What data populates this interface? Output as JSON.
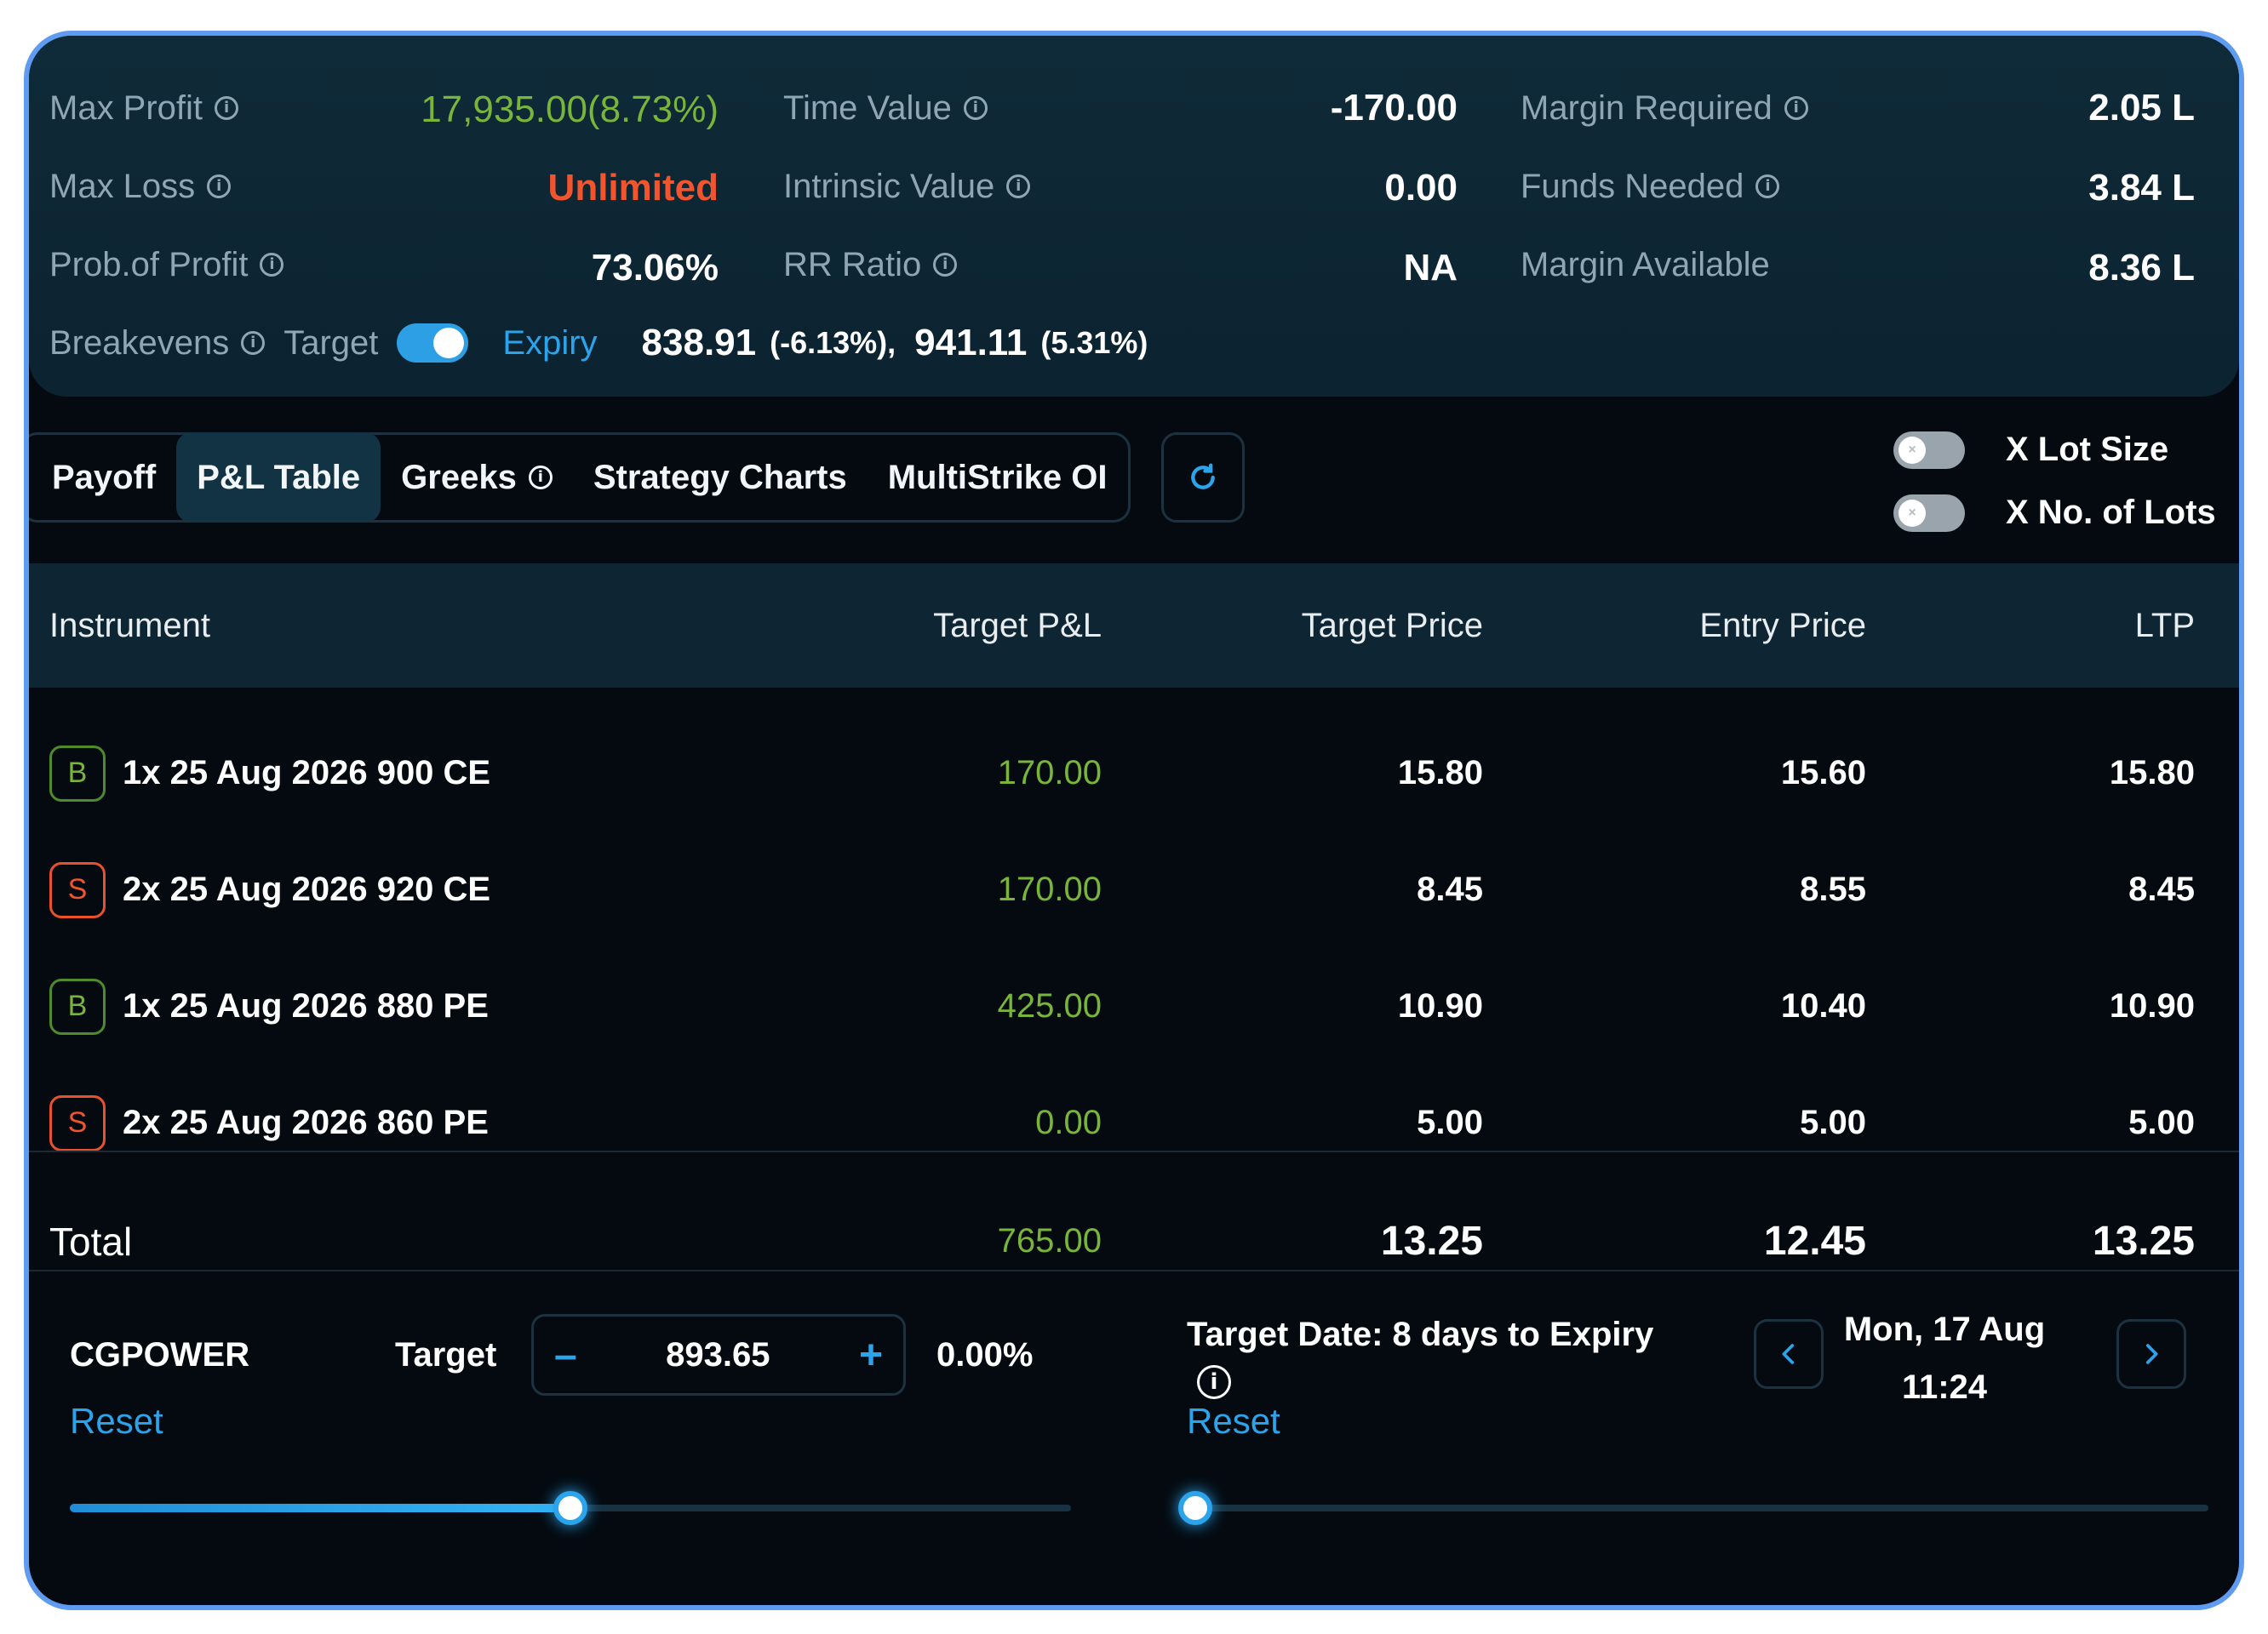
{
  "summary": {
    "max_profit_label": "Max Profit",
    "max_profit_value": "17,935.00(8.73%)",
    "max_loss_label": "Max Loss",
    "max_loss_value": "Unlimited",
    "prob_profit_label": "Prob.of Profit",
    "prob_profit_value": "73.06%",
    "time_value_label": "Time Value",
    "time_value_value": "-170.00",
    "intrinsic_value_label": "Intrinsic Value",
    "intrinsic_value_value": "0.00",
    "rr_ratio_label": "RR Ratio",
    "rr_ratio_value": "NA",
    "margin_required_label": "Margin Required",
    "margin_required_value": "2.05 L",
    "funds_needed_label": "Funds Needed",
    "funds_needed_value": "3.84 L",
    "margin_available_label": "Margin Available",
    "margin_available_value": "8.36 L",
    "breakevens_label": "Breakevens",
    "target_label": "Target",
    "expiry_label": "Expiry",
    "breakeven_1": "838.91",
    "breakeven_1_pct": "(-6.13%),",
    "breakeven_2": "941.11",
    "breakeven_2_pct": "(5.31%)"
  },
  "tabs": [
    {
      "label": "Payoff"
    },
    {
      "label": "P&L Table"
    },
    {
      "label": "Greeks"
    },
    {
      "label": "Strategy Charts"
    },
    {
      "label": "MultiStrike OI"
    }
  ],
  "options": {
    "lot_size_label": "X Lot Size",
    "no_of_lots_label": "X No. of Lots"
  },
  "table": {
    "headers": {
      "instrument": "Instrument",
      "target_pnl": "Target P&L",
      "target_price": "Target Price",
      "entry_price": "Entry Price",
      "ltp": "LTP"
    },
    "rows": [
      {
        "side": "B",
        "instrument": "1x 25 Aug 2026 900 CE",
        "target_pnl": "170.00",
        "target_price": "15.80",
        "entry_price": "15.60",
        "ltp": "15.80"
      },
      {
        "side": "S",
        "instrument": "2x 25 Aug 2026 920 CE",
        "target_pnl": "170.00",
        "target_price": "8.45",
        "entry_price": "8.55",
        "ltp": "8.45"
      },
      {
        "side": "B",
        "instrument": "1x 25 Aug 2026 880 PE",
        "target_pnl": "425.00",
        "target_price": "10.90",
        "entry_price": "10.40",
        "ltp": "10.90"
      },
      {
        "side": "S",
        "instrument": "2x 25 Aug 2026 860 PE",
        "target_pnl": "0.00",
        "target_price": "5.00",
        "entry_price": "5.00",
        "ltp": "5.00"
      }
    ],
    "total": {
      "label": "Total",
      "target_pnl": "765.00",
      "target_price": "13.25",
      "entry_price": "12.45",
      "ltp": "13.25"
    }
  },
  "controls": {
    "symbol": "CGPOWER",
    "target_label": "Target",
    "target_price": "893.65",
    "minus_label": "–",
    "plus_label": "+",
    "target_change": "0.00%",
    "reset_label": "Reset",
    "target_date_label": "Target Date: 8 days to Expiry",
    "date_reset_label": "Reset",
    "date_value": "Mon, 17 Aug",
    "time_value": "11:24",
    "price_slider_fraction": 0.5,
    "date_slider_fraction": 0.0
  },
  "colors": {
    "accent": "#2ca4ec",
    "profit": "#79b53a",
    "loss": "#f2542d",
    "frame": "#5f9bf0"
  }
}
